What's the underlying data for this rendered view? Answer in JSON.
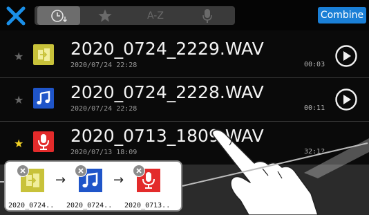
{
  "header": {
    "combine_label": "Combine",
    "sort_tabs": [
      {
        "name": "date-sort",
        "icon": "clock-down-icon",
        "label": "",
        "active": true
      },
      {
        "name": "favorite-sort",
        "icon": "star-icon",
        "label": "",
        "active": false
      },
      {
        "name": "name-sort",
        "icon": "",
        "label": "A-Z",
        "active": false
      },
      {
        "name": "mic-sort",
        "icon": "microphone-icon",
        "label": "",
        "active": false
      }
    ]
  },
  "files": [
    {
      "name": "2020_0724_2229.WAV",
      "date": "2020/07/24 22:28",
      "duration": "00:03",
      "favorite": false,
      "icon": "import-icon",
      "icon_color": "#c8c23a"
    },
    {
      "name": "2020_0724_2228.WAV",
      "date": "2020/07/24 22:28",
      "duration": "00:11",
      "favorite": false,
      "icon": "music-note-icon",
      "icon_color": "#1f55c9"
    },
    {
      "name": "2020_0713_1809.WAV",
      "date": "2020/07/13 18:09",
      "duration": "32:1?",
      "favorite": true,
      "icon": "microphone-icon",
      "icon_color": "#e32b2b"
    }
  ],
  "combine_queue": {
    "items": [
      {
        "label": "2020_0724..",
        "icon": "import-icon",
        "color": "#c8c23a"
      },
      {
        "label": "2020_0724..",
        "icon": "music-note-icon",
        "color": "#1f55c9"
      },
      {
        "label": "2020_0713..",
        "icon": "microphone-icon",
        "color": "#e32b2b"
      }
    ],
    "arrow": "→"
  },
  "colors": {
    "accent": "#1a7fd6",
    "favorite": "#f2d224"
  }
}
